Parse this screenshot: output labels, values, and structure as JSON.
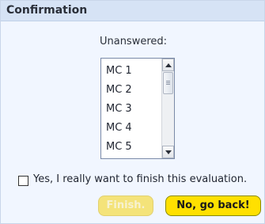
{
  "dialog": {
    "title": "Confirmation",
    "unanswered_label": "Unanswered:",
    "unanswered_items": [
      "MC 1",
      "MC 2",
      "MC 3",
      "MC 4",
      "MC 5"
    ],
    "confirm_checkbox": {
      "label": "Yes, I really want to finish this evaluation.",
      "checked": false
    },
    "buttons": {
      "finish_label": "Finish.",
      "finish_enabled": false,
      "back_label": "No, go back!"
    }
  },
  "colors": {
    "titlebar_bg": "#d6e3f5",
    "panel_bg": "#f1f6ff",
    "button_yellow": "#ffe000"
  },
  "icons": {
    "scroll_up": "arrow-up-icon",
    "scroll_down": "arrow-down-icon",
    "checkbox": "checkbox-unchecked-icon"
  }
}
